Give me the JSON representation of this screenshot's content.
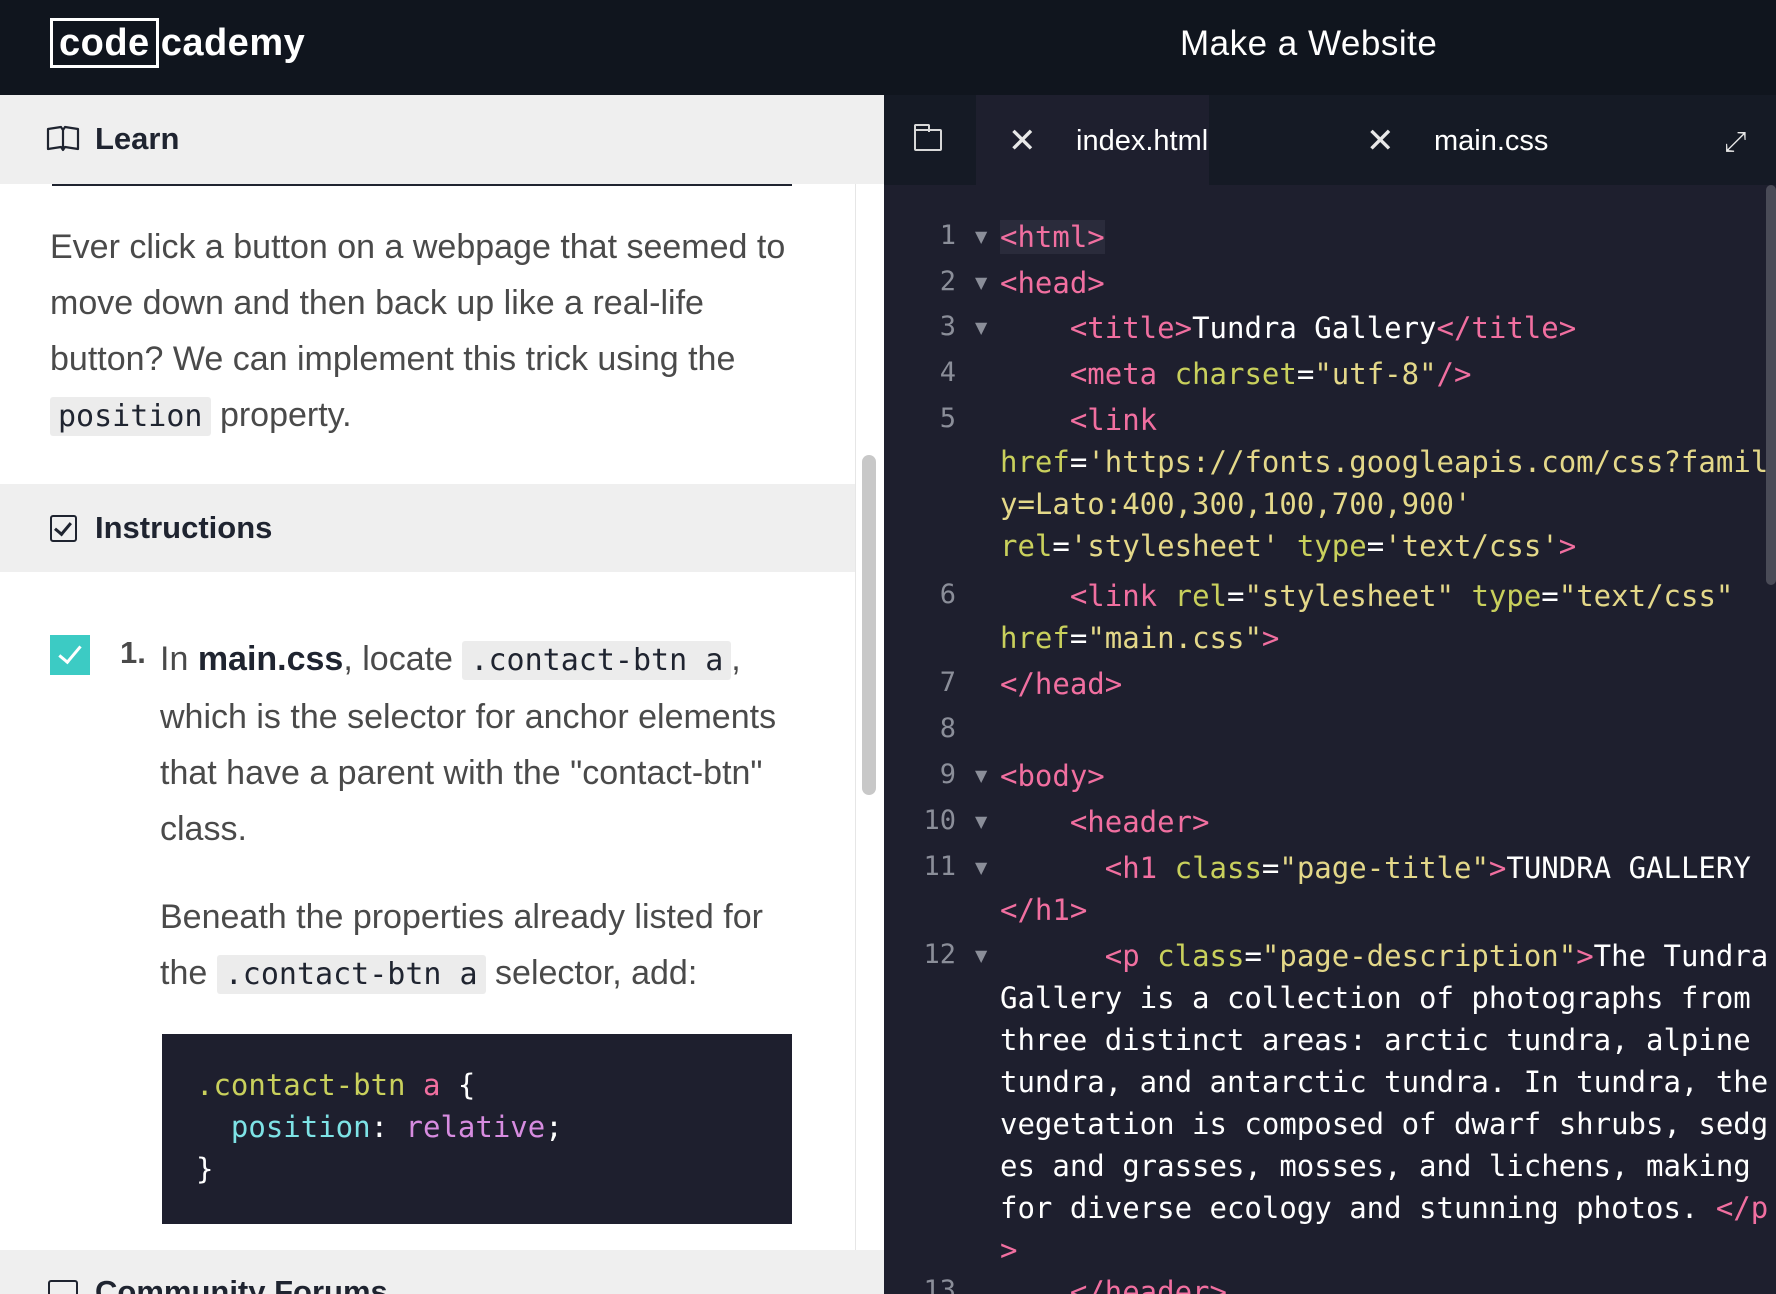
{
  "header": {
    "logo_box": "code",
    "logo_rest": "cademy",
    "title": "Make a Website"
  },
  "learn": {
    "title": "Learn",
    "para_1": "Ever click a button on a webpage that seemed to move down and then back up like a real-life button? We can implement this trick using the ",
    "para_code": "position",
    "para_2": " property."
  },
  "instructions": {
    "title": "Instructions",
    "step_number": "1.",
    "step_text_1": "In ",
    "step_file": "main.css",
    "step_text_2": ", locate ",
    "step_code": ".contact-btn a",
    "step_text_3": ", which is the selector for anchor elements that have a parent with the \"contact-btn\" class.",
    "step2_text_1": "Beneath the properties already listed for the ",
    "step2_code": ".contact-btn a",
    "step2_text_2": " selector, add:",
    "code_selector": ".contact-btn",
    "code_a": "a",
    "code_open": " {",
    "code_prop": "position",
    "code_colon": ": ",
    "code_value": "relative",
    "code_semi": ";",
    "code_close": "}"
  },
  "community": {
    "title": "Community Forums"
  },
  "editor": {
    "tabs": [
      {
        "name": "index.html",
        "active": true
      },
      {
        "name": "main.css",
        "active": false
      }
    ],
    "line_numbers": [
      "1",
      "2",
      "3",
      "4",
      "5",
      "6",
      "7",
      "8",
      "9",
      "10",
      "11",
      "12",
      "13"
    ],
    "lines": {
      "l1_tag": "<html>",
      "l2_tag": "<head>",
      "l3_open": "<title>",
      "l3_text": "Tundra Gallery",
      "l3_close": "</title>",
      "l4_tag": "<meta",
      "l4_attr": " charset",
      "l4_eq": "=",
      "l4_val": "\"utf-8\"",
      "l4_end": "/>",
      "l5_tag": "<link",
      "l5_attr1": "href",
      "l5_eq1": "=",
      "l5_val1": "'https://fonts.googleapis.com/css?family=Lato:400,300,100,700,900'",
      "l5_attr2": "rel",
      "l5_eq2": "=",
      "l5_val2": "'stylesheet'",
      "l5_attr3": " type",
      "l5_eq3": "=",
      "l5_val3": "'text/css'",
      "l5_end": ">",
      "l6_tag": "<link",
      "l6_attr1": " rel",
      "l6_eq1": "=",
      "l6_val1": "\"stylesheet\"",
      "l6_attr2": " type",
      "l6_eq2": "=",
      "l6_val2": "\"text/css\"",
      "l6_attr3": "href",
      "l6_eq3": "=",
      "l6_val3": "\"main.css\"",
      "l6_end": ">",
      "l7_tag": "</head>",
      "l9_tag": "<body>",
      "l10_tag": "<header>",
      "l11_tag": "<h1",
      "l11_attr": " class",
      "l11_eq": "=",
      "l11_val": "\"page-title\"",
      "l11_gt": ">",
      "l11_text": "TUNDRA GALLERY",
      "l11_close": "</h1>",
      "l12_tag": "<p",
      "l12_attr": " class",
      "l12_eq": "=",
      "l12_val": "\"page-description\"",
      "l12_gt": ">",
      "l12_text": "The Tundra Gallery is a collection of photographs from three distinct areas: arctic tundra, alpine tundra, and antarctic tundra. In tundra, the vegetation is composed of dwarf shrubs, sedges and grasses, mosses, and lichens, making for diverse ecology and stunning photos. ",
      "l12_close": "</p>",
      "l13_tag": "</header>"
    }
  }
}
